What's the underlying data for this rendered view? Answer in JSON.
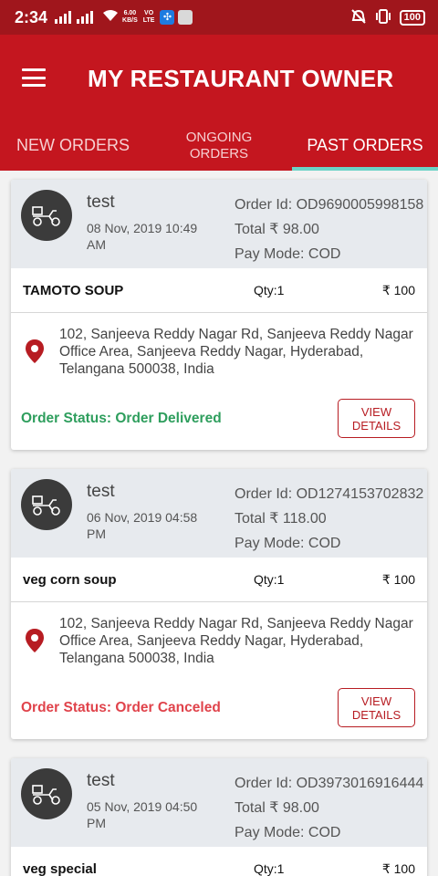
{
  "status_bar": {
    "time": "2:34",
    "speed_top": "6.00",
    "speed_bottom": "KB/S",
    "network_top": "VO",
    "network_bottom": "LTE",
    "battery": "100"
  },
  "app_bar": {
    "title": "MY RESTAURANT OWNER"
  },
  "tabs": [
    {
      "label": "NEW ORDERS",
      "active": false
    },
    {
      "label_line1": "ONGOING",
      "label_line2": "ORDERS",
      "active": false
    },
    {
      "label": "PAST ORDERS",
      "active": true
    }
  ],
  "orders": [
    {
      "customer": "test",
      "date": "08 Nov, 2019 10:49 AM",
      "order_id": "Order Id: OD9690005998158",
      "total": "Total ₹ 98.00",
      "pay_mode": "Pay Mode: COD",
      "item": {
        "name": "TAMOTO SOUP",
        "qty": "Qty:1",
        "price": "₹ 100"
      },
      "address": "102, Sanjeeva Reddy Nagar Rd, Sanjeeva Reddy Nagar Office Area, Sanjeeva Reddy Nagar, Hyderabad, Telangana 500038, India",
      "status": "Order Status: Order Delivered",
      "button_line1": "VIEW",
      "button_line2": "DETAILS"
    },
    {
      "customer": "test",
      "date": "06 Nov, 2019 04:58 PM",
      "order_id": "Order Id: OD1274153702832",
      "total": "Total ₹ 118.00",
      "pay_mode": "Pay Mode: COD",
      "item": {
        "name": "veg corn soup",
        "qty": "Qty:1",
        "price": "₹ 100"
      },
      "address": "102, Sanjeeva Reddy Nagar Rd, Sanjeeva Reddy Nagar Office Area, Sanjeeva Reddy Nagar, Hyderabad, Telangana 500038, India",
      "status": "Order Status: Order Canceled",
      "button_line1": "VIEW",
      "button_line2": "DETAILS"
    },
    {
      "customer": "test",
      "date": "05 Nov, 2019 04:50 PM",
      "order_id": "Order Id: OD3973016916444",
      "total": "Total ₹ 98.00",
      "pay_mode": "Pay Mode: COD",
      "item": {
        "name": "veg special",
        "qty": "Qty:1",
        "price": "₹ 100"
      }
    }
  ],
  "colors": {
    "primary": "#c4161f",
    "status_bar": "#a0161c",
    "tab_indicator": "#6cd3c6",
    "delivered": "#2e9e5d",
    "canceled": "#e0434b"
  },
  "icons": {
    "menu": "hamburger-icon",
    "avatar": "delivery-scooter-icon",
    "location": "map-pin-icon"
  }
}
